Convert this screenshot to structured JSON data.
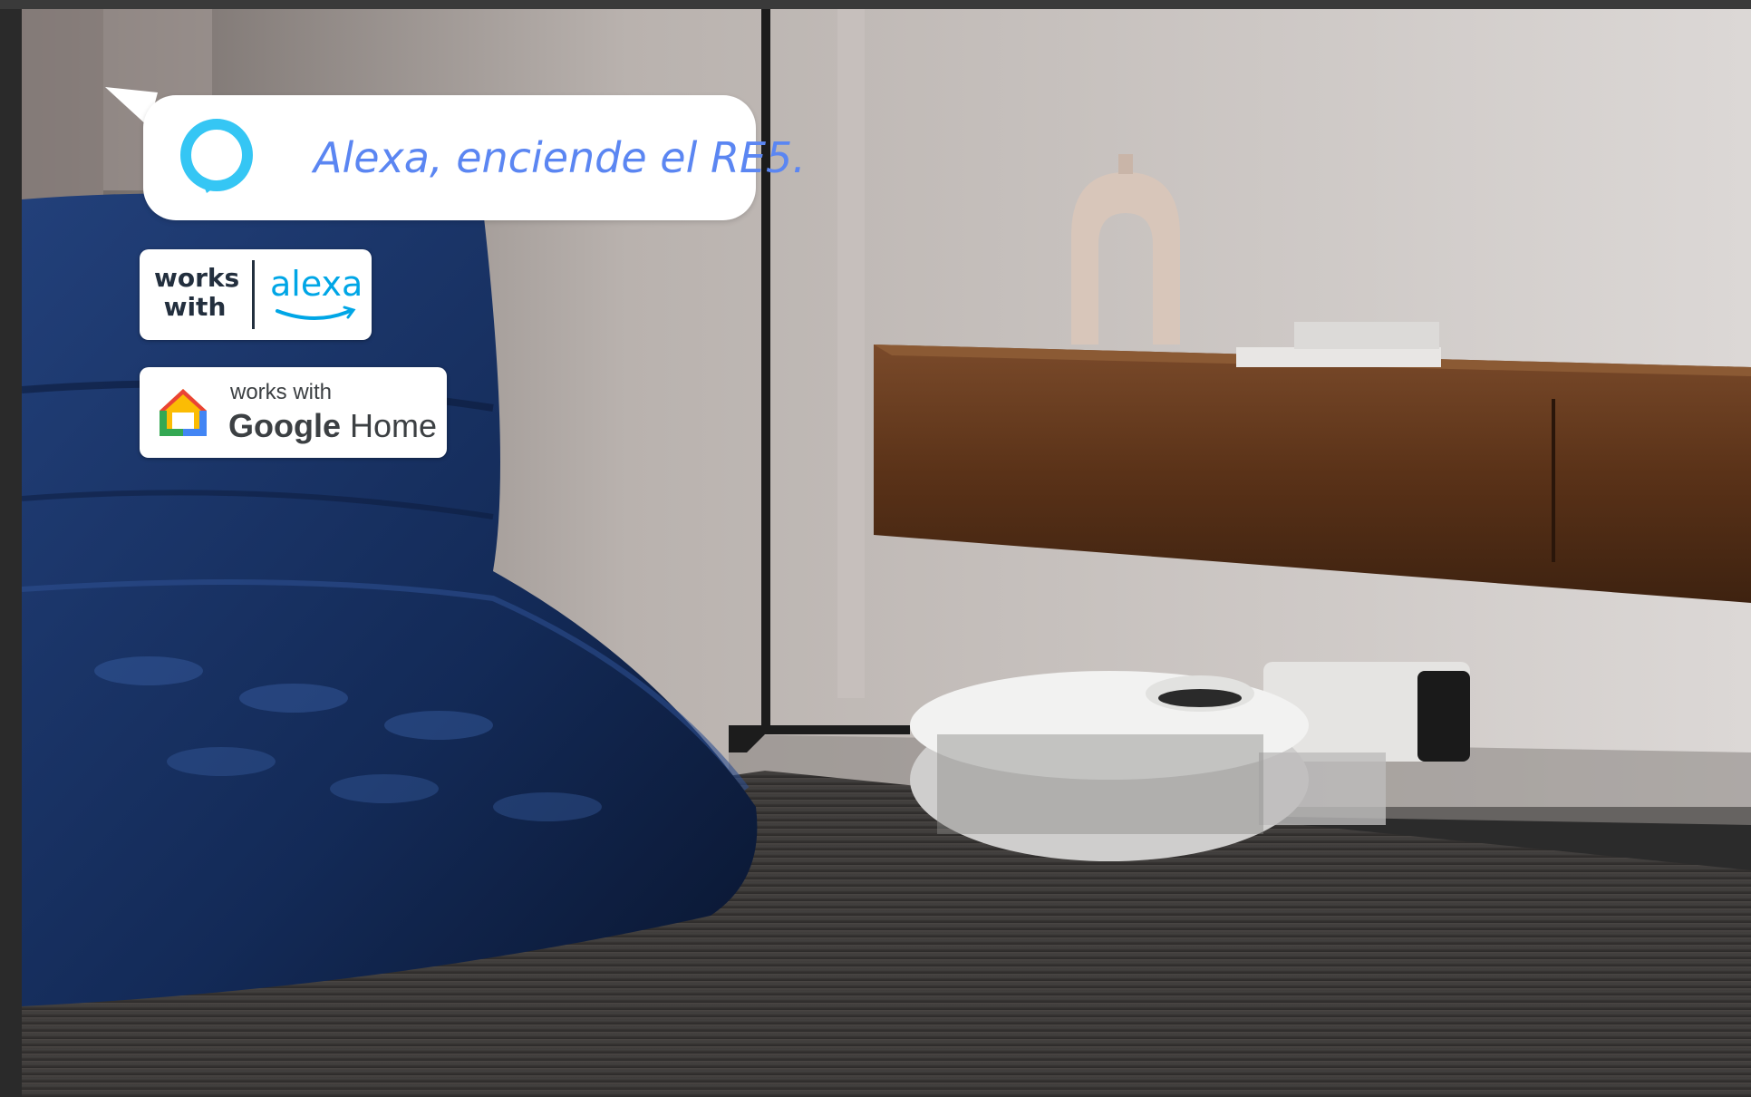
{
  "speech_bubble": {
    "text": "Alexa, enciende el RE5.",
    "icon": "alexa-ring-icon",
    "text_color": "#5b86f2",
    "icon_color": "#35c6f4"
  },
  "badges": {
    "alexa": {
      "works_with": "works\nwith",
      "brand": "alexa",
      "brand_color": "#00a6e6"
    },
    "google": {
      "works_with": "works with",
      "brand_google": "Google",
      "brand_home": " Home"
    }
  },
  "scene": {
    "description_icons": [
      "bean-bag-chair",
      "floor-lamp",
      "wall-shelf",
      "vase",
      "books",
      "robot-vacuum",
      "docking-station",
      "carpet"
    ]
  }
}
